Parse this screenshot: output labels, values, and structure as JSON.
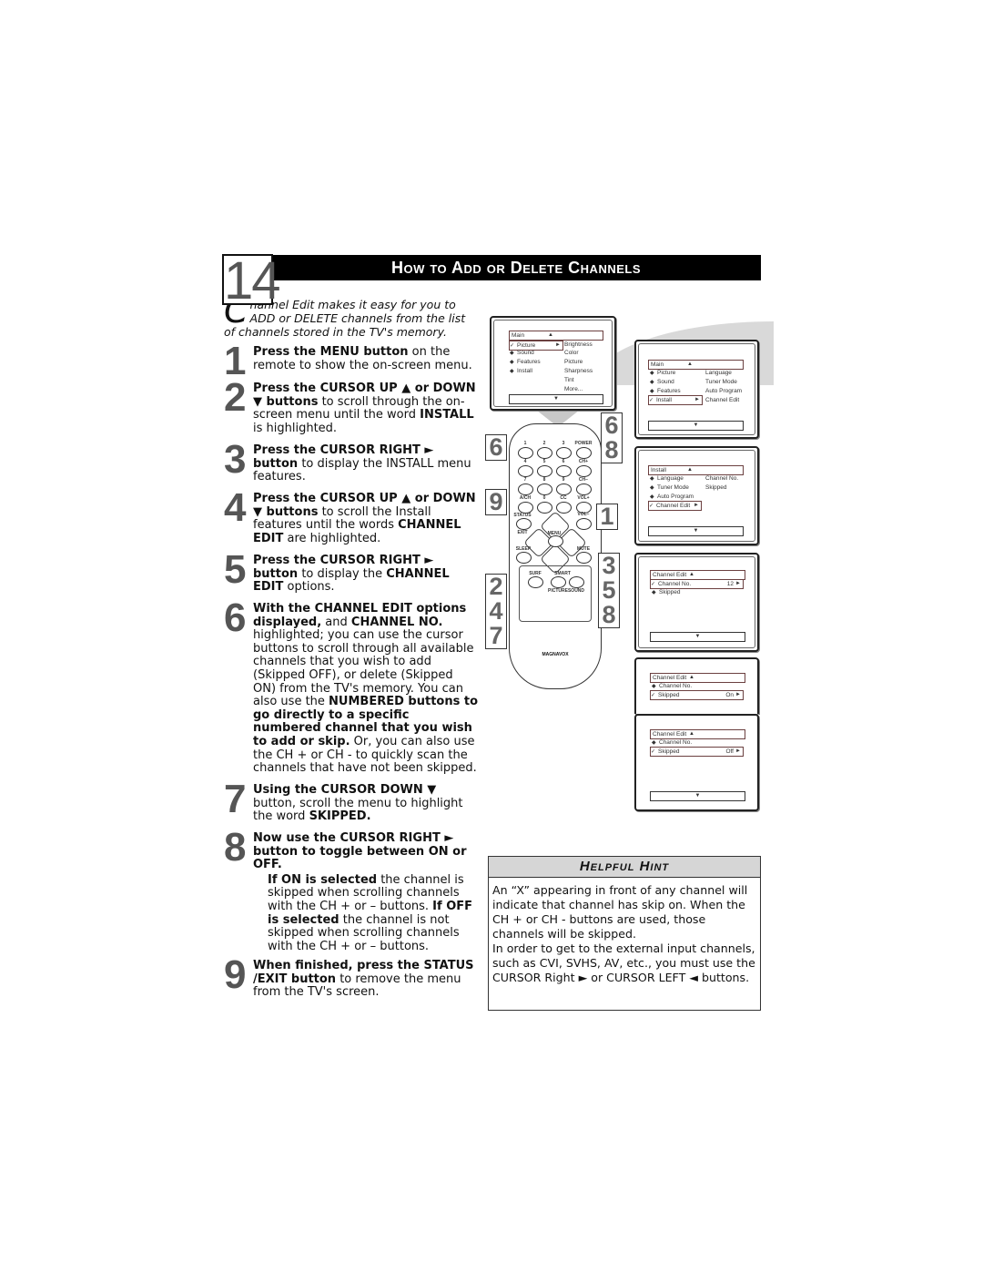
{
  "header": {
    "page_number": "14",
    "title": "How to Add or Delete Channels"
  },
  "intro": {
    "dropcap": "C",
    "text": "hannel Edit makes it easy for you to ADD or DELETE channels from the list of channels stored in the TV's memory."
  },
  "steps": [
    {
      "num": "1",
      "bold": "Press the MENU button",
      "rest": " on the remote to show the on-screen menu."
    },
    {
      "num": "2",
      "bold": "Press the CURSOR UP ▲ or DOWN ▼ buttons",
      "rest": " to scroll through the on-screen menu until the word ",
      "bold2": "INSTALL",
      "rest2": " is highlighted."
    },
    {
      "num": "3",
      "bold": "Press the CURSOR RIGHT ► button",
      "rest": " to display the INSTALL menu features."
    },
    {
      "num": "4",
      "bold": "Press the CURSOR UP ▲ or DOWN ▼ buttons",
      "rest": " to scroll the Install features until the words ",
      "bold2": "CHANNEL EDIT",
      "rest2": " are highlighted."
    },
    {
      "num": "5",
      "bold": "Press the CURSOR RIGHT ► button",
      "rest": " to display the ",
      "bold2": "CHANNEL EDIT",
      "rest2": " options."
    },
    {
      "num": "6",
      "bold": "With the CHANNEL EDIT options displayed,",
      "rest": " and ",
      "bold2": "CHANNEL NO.",
      "rest2": " highlighted; you can use the cursor buttons to scroll through all available channels that you wish to add (Skipped OFF), or delete (Skipped ON) from the TV's memory. You can also use the ",
      "bold3": "NUMBERED buttons to go directly to a specific numbered channel that you wish to add or skip.",
      "rest3": " Or, you can also use the CH + or CH - to quickly scan the channels that have not been skipped."
    },
    {
      "num": "7",
      "bold": "Using the CURSOR DOWN ▼",
      "rest": " button, scroll the menu to highlight the word ",
      "bold2": "SKIPPED.",
      "rest2": ""
    },
    {
      "num": "8",
      "bold": "Now use the CURSOR RIGHT ► button to toggle between ON or OFF.",
      "rest": "",
      "sub_bold": "If ON is selected",
      "sub_rest": " the channel is skipped when scrolling channels with the CH + or – buttons. ",
      "sub_bold2": "If OFF is selected",
      "sub_rest2": " the channel is not skipped when scrolling channels with the CH + or – buttons."
    },
    {
      "num": "9",
      "bold": "When finished, press the STATUS /EXIT button",
      "rest": " to remove the menu from the TV's screen."
    }
  ],
  "menus": {
    "main_picture": {
      "bar": "Main",
      "items": [
        "Picture",
        "Sound",
        "Features",
        "Install"
      ],
      "sub": [
        "Brightness",
        "Color",
        "Picture",
        "Sharpness",
        "Tint",
        "More..."
      ]
    },
    "main_install": {
      "bar": "Main",
      "items": [
        "Picture",
        "Sound",
        "Features",
        "Install"
      ],
      "sub": [
        "Language",
        "Tuner Mode",
        "Auto Program",
        "Channel Edit"
      ]
    },
    "install": {
      "bar": "Install",
      "items": [
        "Language",
        "Tuner Mode",
        "Auto Program",
        "Channel Edit"
      ],
      "sub": [
        "Channel No.",
        "Skipped"
      ]
    },
    "channel_edit_no": {
      "bar": "Channel Edit",
      "items": [
        "Channel No.",
        "Skipped"
      ],
      "value": "12"
    },
    "channel_edit_on": {
      "bar": "Channel Edit",
      "items": [
        "Channel No.",
        "Skipped"
      ],
      "value": "On"
    },
    "channel_edit_off": {
      "bar": "Channel Edit",
      "items": [
        "Channel No.",
        "Skipped"
      ],
      "value": "Off"
    }
  },
  "remote": {
    "brand": "MAGNAVOX",
    "buttons": [
      "1",
      "2",
      "3",
      "POWER",
      "4",
      "5",
      "6",
      "CH+",
      "7",
      "8",
      "9",
      "CH−",
      "A/CH",
      "0",
      "CC",
      "VOL+",
      "STATUS",
      "VOL−",
      "EXIT",
      "MENU",
      "SLEEP",
      "MUTE",
      "SURF",
      "SMART",
      "PICTURE",
      "SOUND"
    ],
    "callouts": {
      "left_top": "6",
      "left_mid": "9",
      "left_bottom": "2\n4\n7",
      "right_top": "6\n8",
      "right_mid": "1",
      "right_bottom": "3\n5\n8"
    }
  },
  "hint": {
    "title": "Helpful Hint",
    "p1": "An “X” appearing in front of any channel will indicate that channel has skip on. When the CH + or CH - buttons are used, those channels will be skipped.",
    "p2": "In order to get to the external input channels, such as CVI, SVHS, AV, etc., you must use the CURSOR Right ► or CURSOR LEFT ◄ buttons."
  }
}
